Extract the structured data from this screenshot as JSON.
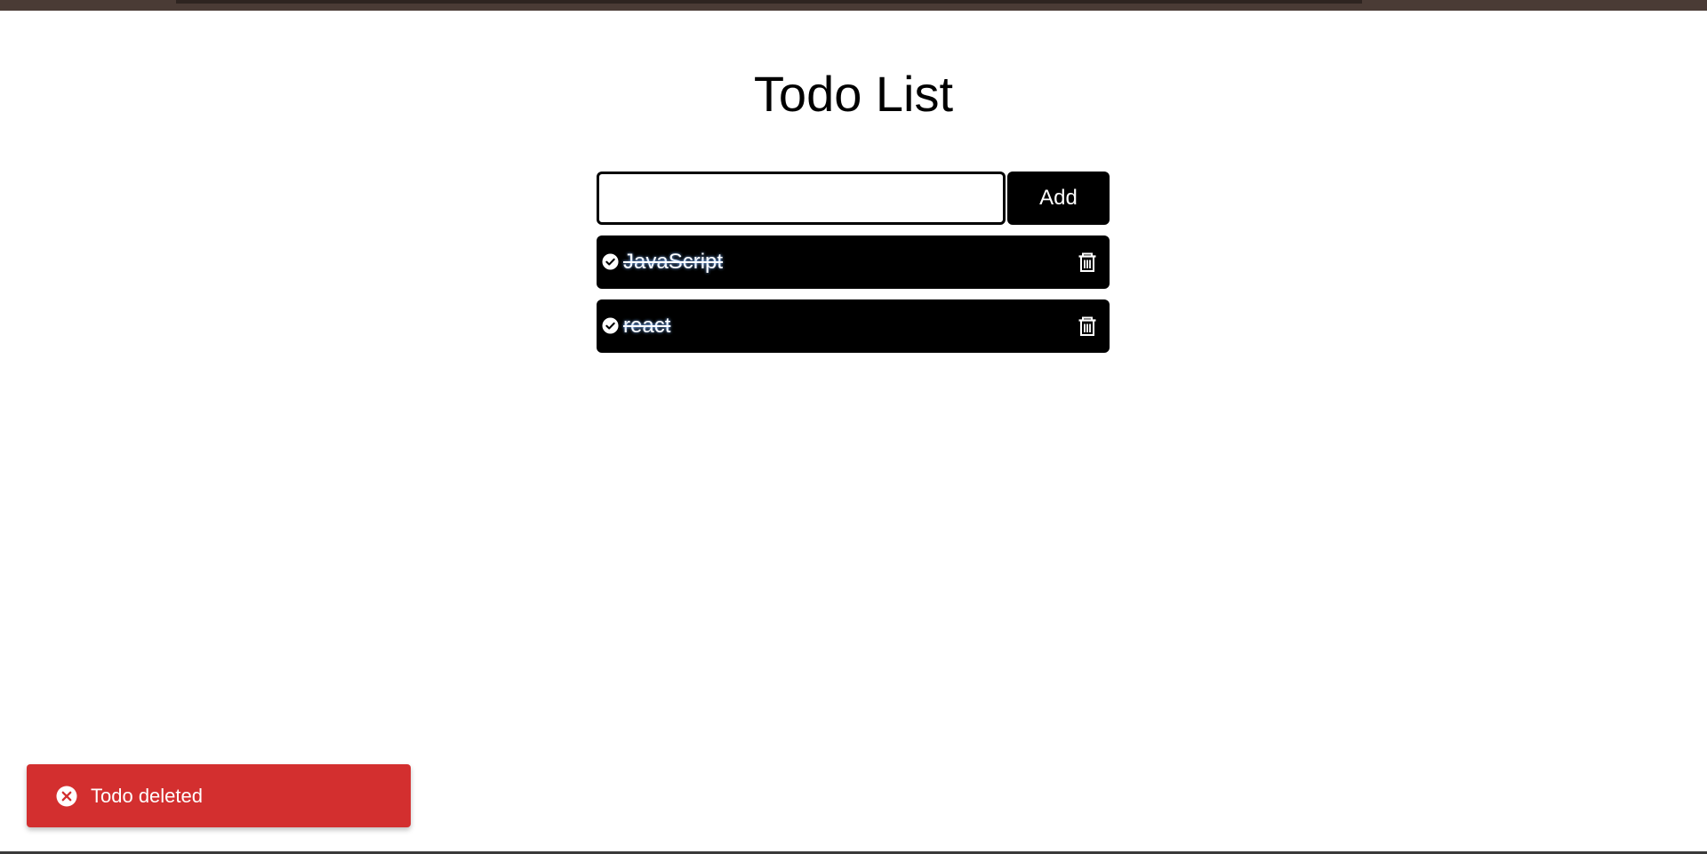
{
  "app": {
    "title": "Todo List"
  },
  "form": {
    "input_value": "",
    "input_placeholder": "",
    "add_label": "Add"
  },
  "todos": [
    {
      "text": "JavaScript",
      "completed": true,
      "check_icon": "check-circle-icon",
      "delete_icon": "trash-icon"
    },
    {
      "text": "react",
      "completed": true,
      "check_icon": "check-circle-icon",
      "delete_icon": "trash-icon"
    }
  ],
  "toast": {
    "message": "Todo deleted",
    "icon": "error-circle-icon",
    "color": "#d32f2f"
  },
  "colors": {
    "todo_background": "#000000",
    "todo_text": "#ffffff",
    "button_background": "#000000",
    "top_bar": "#4a3b35"
  }
}
